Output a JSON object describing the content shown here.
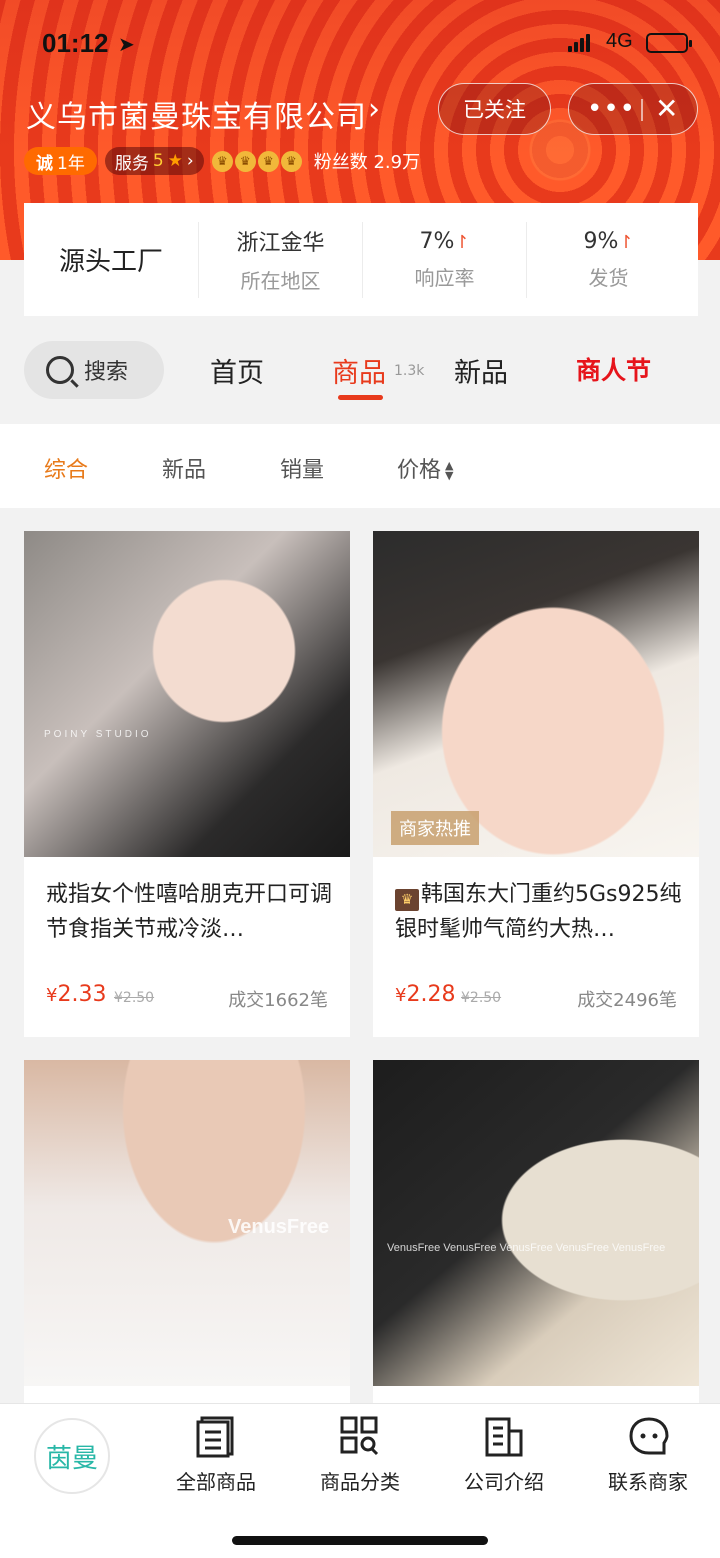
{
  "status_bar": {
    "time": "01:12",
    "network": "4G"
  },
  "shop": {
    "name": "义乌市菌曼珠宝有限公司",
    "follow_label": "已关注",
    "cheng_badge": "诚",
    "cheng_years": "1年",
    "service_label": "服务",
    "service_score": "5",
    "fans_label": "粉丝数 2.9万"
  },
  "info": {
    "main": "源头工厂",
    "stats": [
      {
        "value": "浙江金华",
        "label": "所在地区"
      },
      {
        "value": "7%",
        "label": "响应率"
      },
      {
        "value": "9%",
        "label": "发货"
      }
    ]
  },
  "nav": {
    "search_label": "搜索",
    "tabs": [
      "首页",
      "商品",
      "新品",
      "商人节"
    ],
    "product_count": "1.3k"
  },
  "sort": {
    "items": [
      "综合",
      "新品",
      "销量",
      "价格"
    ]
  },
  "products": [
    {
      "title": "戒指女个性嘻哈朋克开口可调节食指关节戒冷淡…",
      "price": "2.33",
      "orig_price": "¥2.50",
      "sold": "成交1662笔",
      "watermark": "POINY STUDIO"
    },
    {
      "title": "韩国东大门重约5Gs925纯银时髦帅气简约大热…",
      "price": "2.28",
      "orig_price": "¥2.50",
      "sold": "成交2496笔",
      "tag": "商家热推"
    },
    {
      "watermark": "VenusFree"
    },
    {
      "watermark": "VenusFree VenusFree VenusFree VenusFree VenusFree"
    }
  ],
  "bottom_bar": {
    "logo_text": "茵曼",
    "items": [
      "全部商品",
      "商品分类",
      "公司介绍",
      "联系商家"
    ]
  },
  "colors": {
    "accent": "#e83a1c",
    "sort_active": "#e87a1a",
    "logo": "#28b7a7"
  }
}
